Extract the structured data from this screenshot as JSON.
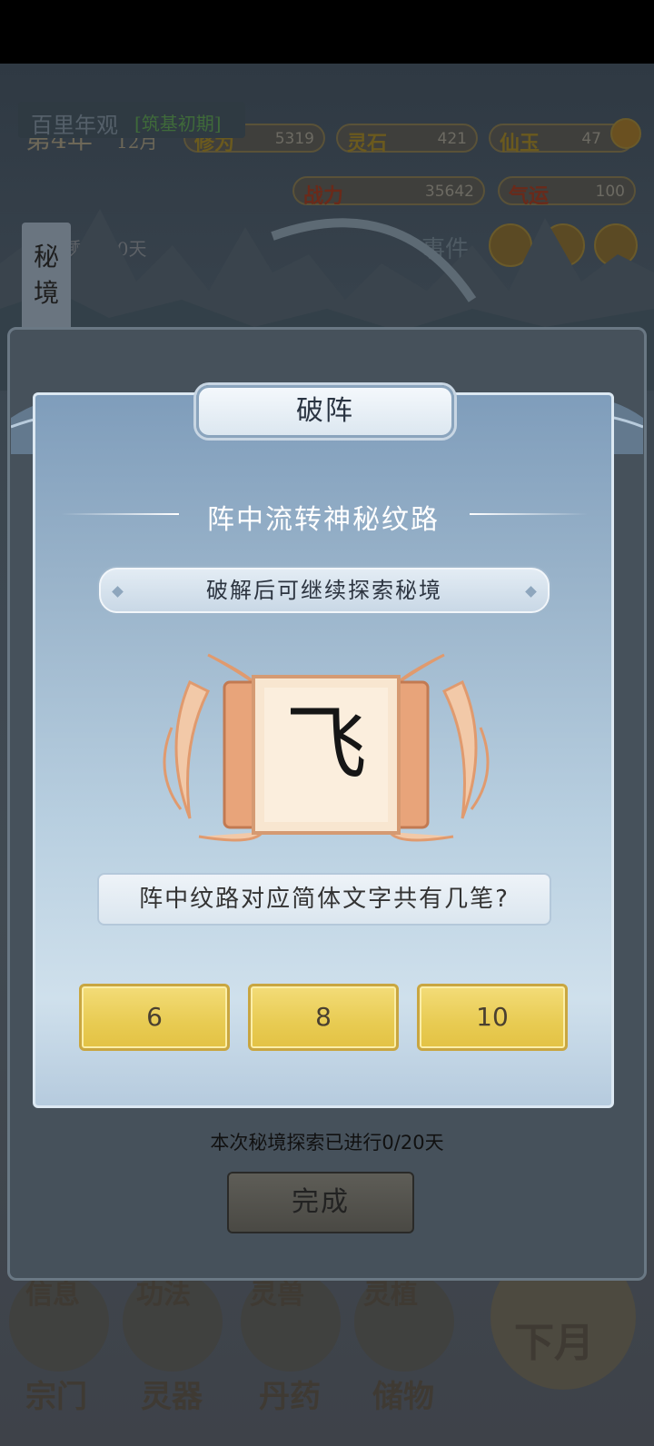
{
  "hud": {
    "year": "第4年",
    "month": "12月",
    "player_name": "百里年观",
    "player_tag": "[筑基初期]",
    "remaining_days": "剩余20天",
    "event_text": "事件",
    "resources": [
      {
        "label": "修为",
        "value": "5319"
      },
      {
        "label": "灵石",
        "value": "421"
      },
      {
        "label": "仙玉",
        "value": "47"
      },
      {
        "label": "战力",
        "value": "35642"
      },
      {
        "label": "气运",
        "value": "100"
      }
    ]
  },
  "side_tag": {
    "line1": "秘",
    "line2": "境"
  },
  "dialog": {
    "title": "破阵",
    "subtitle": "阵中流转神秘纹路",
    "hint": "破解后可继续探索秘境",
    "glyph": "飞",
    "question": "阵中纹路对应简体文字共有几笔?",
    "options": [
      "6",
      "8",
      "10"
    ]
  },
  "footer": {
    "progress_text": "本次秘境探索已进行0/20天",
    "done_label": "完成"
  },
  "bottom_nav": {
    "top_row": [
      "信息",
      "功法",
      "灵兽",
      "灵植"
    ],
    "items": [
      "宗门",
      "灵器",
      "丹药",
      "储物"
    ],
    "next_month": "下月"
  }
}
